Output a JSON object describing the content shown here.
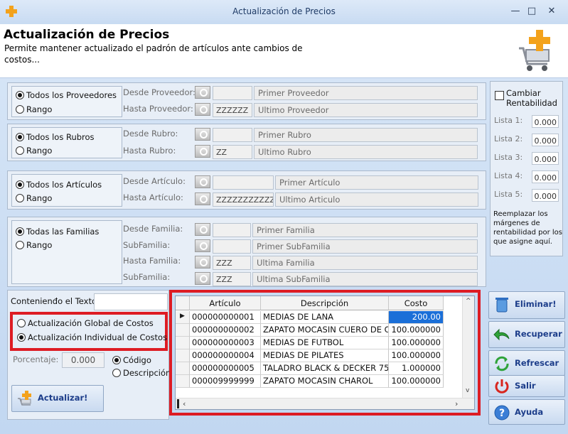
{
  "window": {
    "title": "Actualización de Precios",
    "controls": [
      "—",
      "□",
      "✕"
    ]
  },
  "header": {
    "title": "Actualización de Precios",
    "subtitle": "Permite mantener actualizado el padrón de artículos ante cambios de costos..."
  },
  "proveedores": {
    "opt_all": "Todos los Proveedores",
    "opt_range": "Rango",
    "desde_label": "Desde Proveedor:",
    "hasta_label": "Hasta Proveedor:",
    "desde_code": "",
    "hasta_code": "ZZZZZZ",
    "desde_desc": "Primer Proveedor",
    "hasta_desc": "Ultimo Proveedor"
  },
  "rubros": {
    "opt_all": "Todos los Rubros",
    "opt_range": "Rango",
    "desde_label": "Desde Rubro:",
    "hasta_label": "Hasta Rubro:",
    "desde_code": "",
    "hasta_code": "ZZ",
    "desde_desc": "Primer Rubro",
    "hasta_desc": "Ultimo Rubro"
  },
  "articulos": {
    "opt_all": "Todos los Artículos",
    "opt_range": "Rango",
    "desde_label": "Desde Artículo:",
    "hasta_label": "Hasta Artículo:",
    "desde_code": "",
    "hasta_code": "ZZZZZZZZZZZZ",
    "desde_desc": "Primer Artículo",
    "hasta_desc": "Ultimo Articulo"
  },
  "familias": {
    "opt_all": "Todas las Familias",
    "opt_range": "Rango",
    "desde_label": "Desde Familia:",
    "sub1_label": "SubFamilia:",
    "hasta_label": "Hasta Familia:",
    "sub2_label": "SubFamilia:",
    "desde_code": "",
    "sub1_code": "",
    "hasta_code": "ZZZ",
    "sub2_code": "ZZZ",
    "desde_desc": "Primer Familia",
    "sub1_desc": "Primer SubFamilia",
    "hasta_desc": "Ultima Familia",
    "sub2_desc": "Ultima SubFamilia"
  },
  "rentabilidad": {
    "check_label": "Cambiar Rentabilidad",
    "listas": [
      {
        "label": "Lista 1:",
        "value": "0.000"
      },
      {
        "label": "Lista 2:",
        "value": "0.000"
      },
      {
        "label": "Lista 3:",
        "value": "0.000"
      },
      {
        "label": "Lista 4:",
        "value": "0.000"
      },
      {
        "label": "Lista 5:",
        "value": "0.000"
      }
    ],
    "note": "Reemplazar los márgenes de rentabilidad por los que asigne aquí."
  },
  "options": {
    "texto_label": "Contenienđo el Texto:",
    "texto_value": "",
    "global": "Actualización Global de Costos",
    "individual": "Actualización Individual de Costos",
    "porcentaje_label": "Porcentaje:",
    "porcentaje_value": "0.000",
    "codigo": "Código",
    "descripcion": "Descripción",
    "actualizar": "Actualizar!"
  },
  "grid": {
    "columns": [
      "Artículo",
      "Descripción",
      "Costo"
    ],
    "rows": [
      [
        "000000000001",
        "MEDIAS DE LANA",
        "200.00"
      ],
      [
        "000000000002",
        "ZAPATO MOCASIN CUERO DE C",
        "100.000000"
      ],
      [
        "000000000003",
        "MEDIAS DE FUTBOL",
        "100.000000"
      ],
      [
        "000000000004",
        "MEDIAS DE PILATES",
        "100.000000"
      ],
      [
        "000000000005",
        "TALADRO BLACK & DECKER 75",
        "1.000000"
      ],
      [
        "000009999999",
        "ZAPATO MOCASIN CHAROL",
        "100.000000"
      ]
    ]
  },
  "actions": {
    "eliminar": "Eliminar!",
    "recuperar": "Recuperar",
    "refrescar": "Refrescar",
    "salir": "Salir",
    "ayuda": "Ayuda"
  }
}
